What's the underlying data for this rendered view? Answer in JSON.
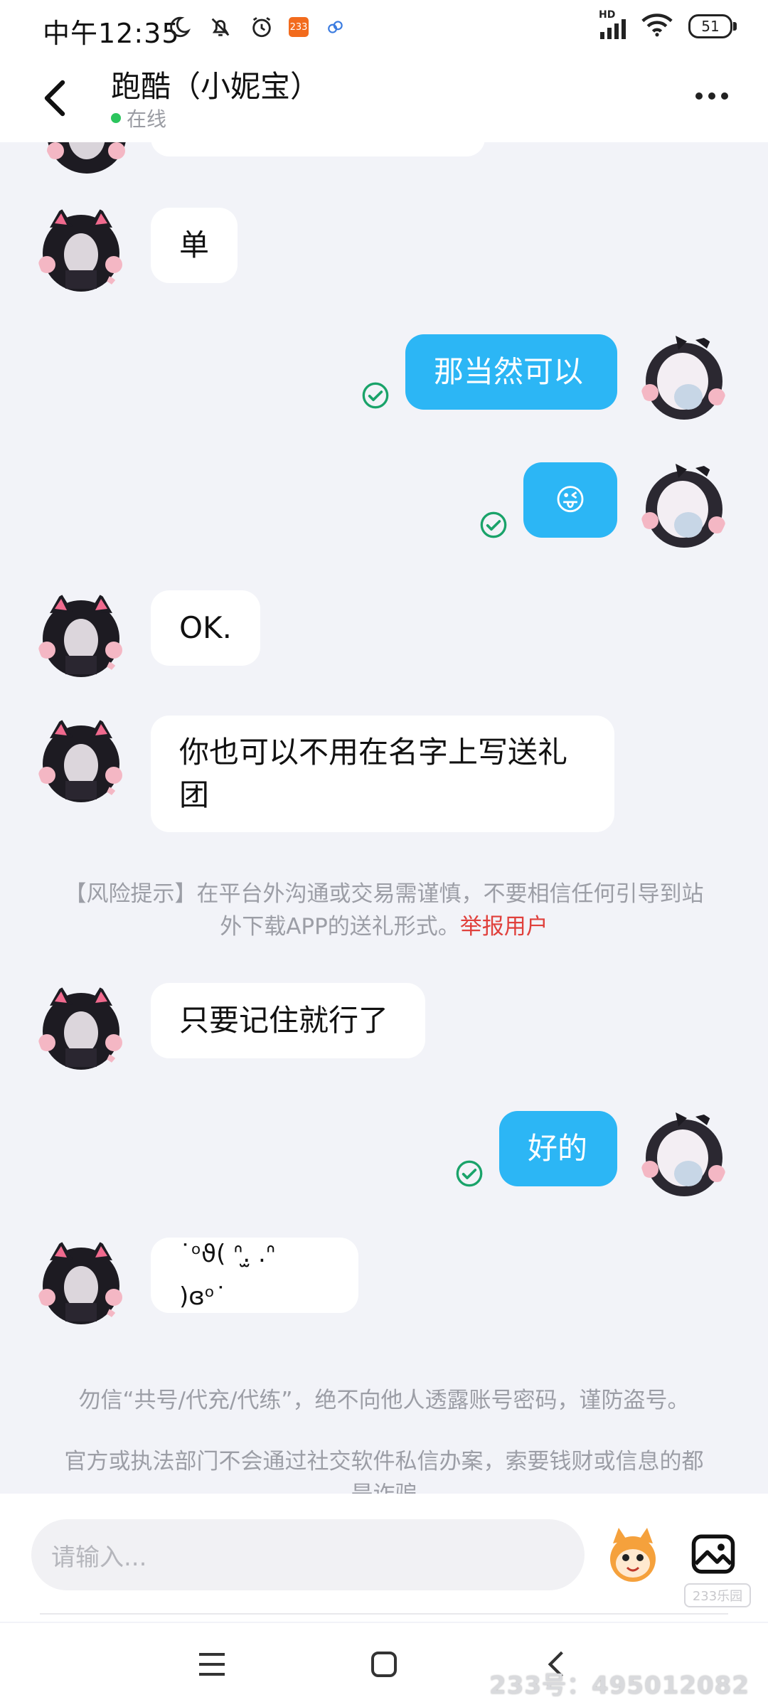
{
  "status_bar": {
    "time": "中午12:35",
    "app_badge": "233",
    "battery": "51",
    "network": "HD"
  },
  "header": {
    "title": "跑酷（小妮宝）",
    "status": "在线"
  },
  "messages": [
    {
      "side": "left",
      "text": "单"
    },
    {
      "side": "right",
      "text": "那当然可以"
    },
    {
      "side": "right",
      "text": "😜"
    },
    {
      "side": "left",
      "text": "OK."
    },
    {
      "side": "left",
      "text": "你也可以不用在名字上写送礼团"
    },
    {
      "side": "left",
      "text": "只要记住就行了"
    },
    {
      "side": "right",
      "text": "好的"
    },
    {
      "side": "left",
      "text": "˙ᵒϑ( ᐢ.̫ .ᐢ )ɞᵒ˙"
    }
  ],
  "risk_notice": {
    "text": "【风险提示】在平台外沟通或交易需谨慎，不要相信任何引导到站外下载APP的送礼形式。",
    "link": "举报用户"
  },
  "footer_notices": [
    "勿信“共号/代充/代练”，绝不向他人透露账号密码，谨防盗号。",
    "官方或执法部门不会通过社交软件私信办案，索要钱财或信息的都是诈骗"
  ],
  "input": {
    "placeholder": "请输入..."
  },
  "watermark": {
    "logo": "233乐园",
    "text": "233号：495012082"
  },
  "colors": {
    "accent": "#2cb6f5",
    "online": "#2bc55d",
    "report": "#e0403c",
    "check": "#1aa36a"
  }
}
